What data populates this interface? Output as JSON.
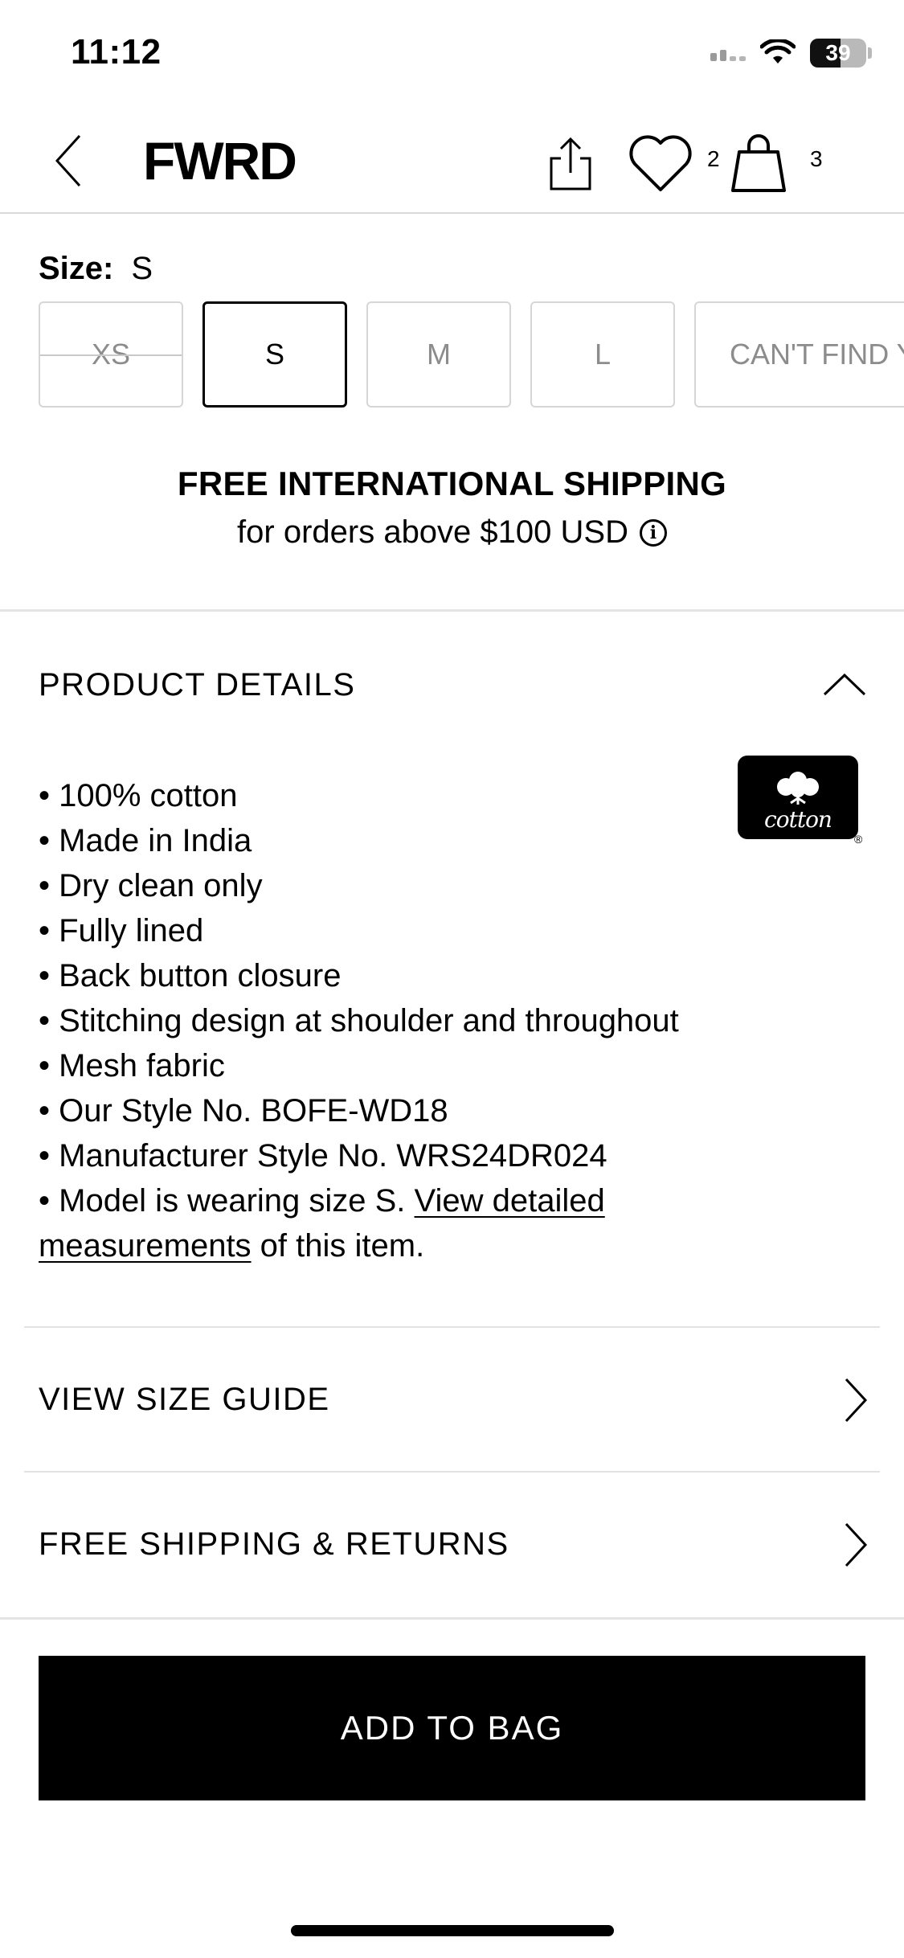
{
  "status_bar": {
    "time": "11:12",
    "battery": "39"
  },
  "header": {
    "logo": "FWRD",
    "wishlist_count": "2",
    "bag_count": "3"
  },
  "size": {
    "label": "Size:",
    "selected": "S",
    "options": [
      {
        "label": "XS",
        "state": "unavailable"
      },
      {
        "label": "S",
        "state": "selected"
      },
      {
        "label": "M",
        "state": "available"
      },
      {
        "label": "L",
        "state": "available"
      },
      {
        "label": "CAN'T FIND Y",
        "state": "available"
      }
    ]
  },
  "shipping_banner": {
    "title": "FREE INTERNATIONAL SHIPPING",
    "subtitle": "for orders above $100 USD"
  },
  "product_details": {
    "title": "PRODUCT DETAILS",
    "badge": "cotton",
    "items": [
      "100% cotton",
      "Made in India",
      "Dry clean only",
      "Fully lined",
      "Back button closure",
      "Stitching design at shoulder and throughout",
      "Mesh fabric",
      "Our Style No. BOFE-WD18",
      "Manufacturer Style No. WRS24DR024"
    ],
    "model_note_prefix": "Model is wearing size S. ",
    "model_note_link": "View detailed measurements",
    "model_note_suffix": " of this item."
  },
  "rows": {
    "size_guide": "VIEW SIZE GUIDE",
    "shipping_returns": "FREE SHIPPING & RETURNS"
  },
  "cta": {
    "add_to_bag": "ADD TO BAG"
  }
}
